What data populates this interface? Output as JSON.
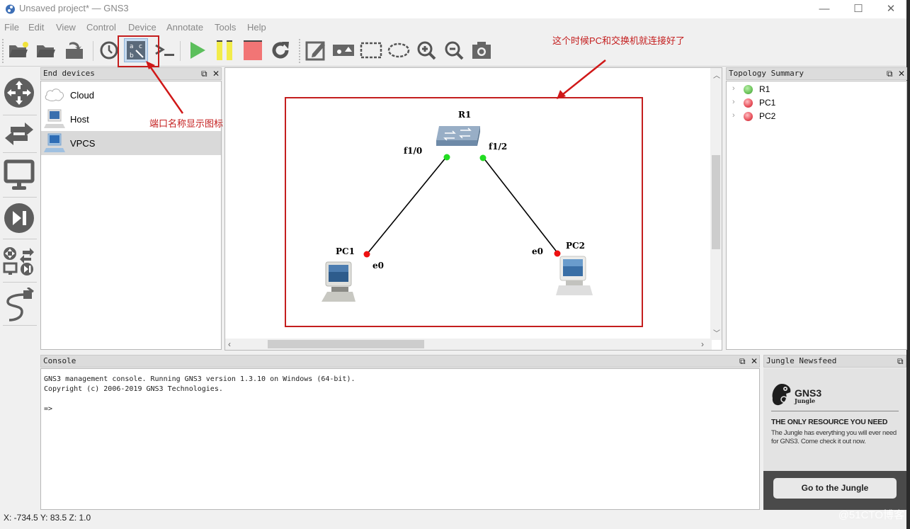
{
  "window": {
    "title": "Unsaved project* — GNS3",
    "controls": {
      "minimize": "—",
      "maximize": "☐",
      "close": "✕"
    }
  },
  "menu": [
    "File",
    "Edit",
    "View",
    "Control",
    "Device",
    "Annotate",
    "Tools",
    "Help"
  ],
  "toolbar": {
    "buttons": [
      {
        "name": "new-project",
        "icon": "folder-new-icon"
      },
      {
        "name": "open-project",
        "icon": "folder-open-icon"
      },
      {
        "name": "save-project",
        "icon": "save-icon"
      },
      {
        "name": "snapshot-history",
        "icon": "clock-icon"
      },
      {
        "name": "show-interface-labels",
        "icon": "interface-labels-icon",
        "active": true
      },
      {
        "name": "console-all",
        "icon": "terminal-icon"
      },
      {
        "name": "start-all",
        "icon": "play-icon"
      },
      {
        "name": "suspend-all",
        "icon": "pause-icon"
      },
      {
        "name": "stop-all",
        "icon": "stop-icon"
      },
      {
        "name": "reload-all",
        "icon": "reload-icon"
      },
      {
        "name": "add-note",
        "icon": "note-icon"
      },
      {
        "name": "insert-image",
        "icon": "image-icon"
      },
      {
        "name": "draw-rectangle",
        "icon": "rectangle-icon"
      },
      {
        "name": "draw-ellipse",
        "icon": "ellipse-icon"
      },
      {
        "name": "zoom-in",
        "icon": "zoom-in-icon"
      },
      {
        "name": "zoom-out",
        "icon": "zoom-out-icon"
      },
      {
        "name": "screenshot",
        "icon": "camera-icon"
      }
    ]
  },
  "leftbar": [
    "routers",
    "switches",
    "end-devices",
    "security-devices",
    "all-devices",
    "add-link"
  ],
  "devices_panel": {
    "title": "End devices",
    "items": [
      {
        "label": "Cloud",
        "icon": "cloud-icon"
      },
      {
        "label": "Host",
        "icon": "host-icon"
      },
      {
        "label": "VPCS",
        "icon": "vpcs-icon",
        "selected": true
      }
    ]
  },
  "topology": {
    "nodes": [
      {
        "name": "R1",
        "type": "switch"
      },
      {
        "name": "PC1",
        "type": "pc"
      },
      {
        "name": "PC2",
        "type": "pc"
      }
    ],
    "links": [
      {
        "from": "R1",
        "from_port": "f1/0",
        "to": "PC1",
        "to_port": "e0"
      },
      {
        "from": "R1",
        "from_port": "f1/2",
        "to": "PC2",
        "to_port": "e0"
      }
    ],
    "port_colors": {
      "up": "#22dd22",
      "down": "#ee1111"
    }
  },
  "topology_summary": {
    "title": "Topology Summary",
    "items": [
      {
        "label": "R1",
        "status": "started",
        "color": "#6cc35a"
      },
      {
        "label": "PC1",
        "status": "stopped",
        "color": "#e8505b"
      },
      {
        "label": "PC2",
        "status": "stopped",
        "color": "#e8505b"
      }
    ]
  },
  "console": {
    "title": "Console",
    "lines": [
      "GNS3 management console. Running GNS3 version 1.3.10 on Windows (64-bit).",
      "Copyright (c) 2006-2019 GNS3 Technologies.",
      "",
      "=>"
    ]
  },
  "jungle": {
    "title": "Jungle Newsfeed",
    "logo_text": "GNS3",
    "logo_sub": "Jungle",
    "headline": "THE ONLY RESOURCE YOU NEED",
    "body": "The Jungle has everything you will ever need for GNS3. Come check it out now.",
    "button": "Go to the Jungle"
  },
  "status": {
    "coords": "X: -734.5 Y: 83.5 Z: 1.0"
  },
  "annotations": {
    "toolbar_note": "端口名称显示图标",
    "canvas_note": "这个时候PC和交换机就连接好了",
    "accent": "#c41e1e"
  },
  "watermark": "@51CTO博客"
}
